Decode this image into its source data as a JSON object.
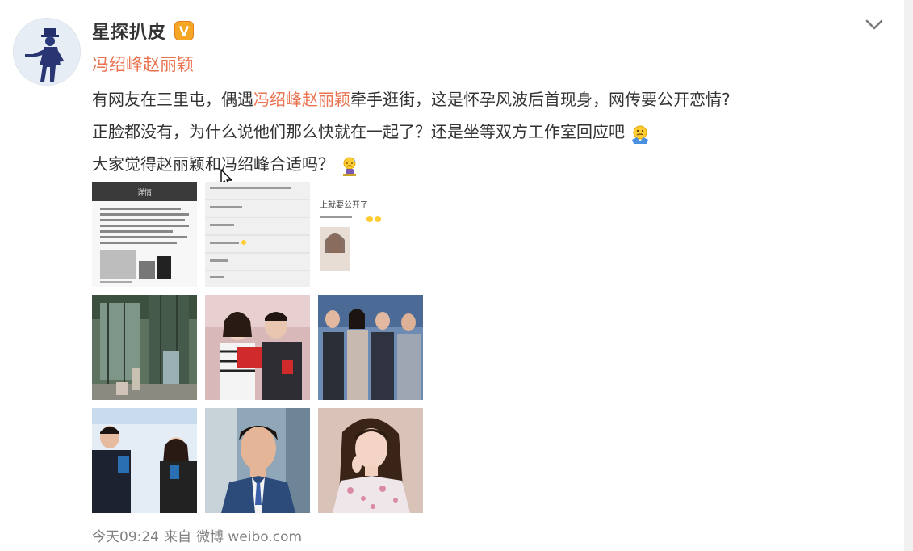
{
  "post": {
    "username": "星探扒皮",
    "verified_badge": "V",
    "topic_link": "冯绍峰赵丽颖",
    "content": {
      "line1_before": "有网友在三里屯，偶遇",
      "line1_link": "冯绍峰赵丽颖",
      "line1_after": "牵手逛街，这是怀孕风波后首现身，网传要公开恋情?",
      "line2": "正脸都没有，为什么说他们那么快就在一起了？还是坐等双方工作室回应吧",
      "line3": "大家觉得赵丽颖和冯绍峰合适吗？"
    },
    "footer": {
      "time": "今天09:24",
      "from_label": "来自",
      "source": "微博 weibo.com"
    }
  },
  "images": [
    {
      "label": "详情",
      "name": "screenshot-article"
    },
    {
      "label": "",
      "name": "screenshot-comments"
    },
    {
      "label": "上就要公开了",
      "name": "screenshot-post"
    },
    {
      "label": "",
      "name": "street-photo"
    },
    {
      "label": "",
      "name": "couple-photo-1"
    },
    {
      "label": "",
      "name": "group-photo"
    },
    {
      "label": "",
      "name": "event-photo"
    },
    {
      "label": "",
      "name": "portrait-man"
    },
    {
      "label": "",
      "name": "portrait-woman"
    }
  ],
  "icons": {
    "avatar": "silhouette-figure-icon",
    "chevron": "chevron-down-icon",
    "emoji1": "shrug-emoji-icon",
    "emoji2": "sweat-emoji-icon",
    "cursor": "mouse-pointer-icon"
  },
  "colors": {
    "link": "#eb7350",
    "text": "#333333",
    "muted": "#808080",
    "badge": "#f5a623"
  }
}
